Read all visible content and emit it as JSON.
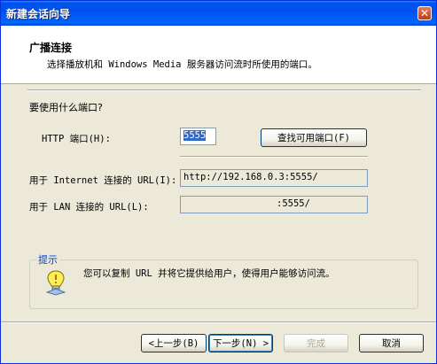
{
  "window": {
    "title": "新建会话向导",
    "close_glyph": "✕"
  },
  "header": {
    "title": "广播连接",
    "subtitle": "选择播放机和 Windows Media 服务器访问流时所使用的端口。"
  },
  "port_section": {
    "question": "要使用什么端口?",
    "http_port_label": "HTTP 端口(H):",
    "http_port_value": "5555",
    "find_port_button": "查找可用端口(F)"
  },
  "urls": {
    "internet_label": "用于 Internet 连接的 URL(I):",
    "internet_value": "http://192.168.0.3:5555/",
    "lan_label": "用于 LAN 连接的 URL(L):",
    "lan_value": ":5555/"
  },
  "hint": {
    "legend": "提示",
    "text": "您可以复制 URL 并将它提供给用户，使得用户能够访问流。"
  },
  "footer": {
    "back_button": "<上一步(B)",
    "next_button": "下一步(N) >",
    "finish_button": "完成",
    "cancel_button": "取消"
  },
  "colors": {
    "title_bar": "#0054e3",
    "hint_legend": "#0046d5",
    "selection": "#316ac5"
  }
}
